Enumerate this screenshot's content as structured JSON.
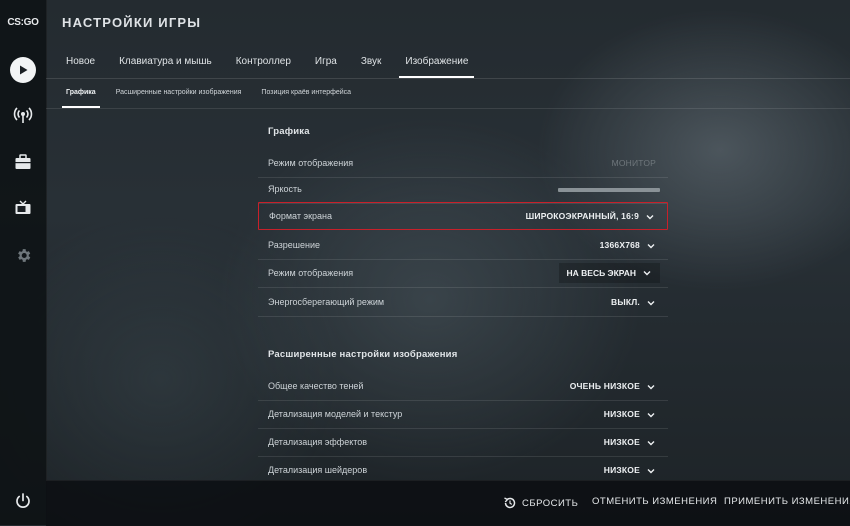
{
  "logo": {
    "text": "CS:GO"
  },
  "rail": {
    "icons": [
      "play-icon",
      "broadcast-icon",
      "briefcase-icon",
      "tv-icon",
      "gear-icon",
      "power-icon"
    ]
  },
  "header": {
    "title": "НАСТРОЙКИ ИГРЫ"
  },
  "tabs": [
    {
      "label": "Новое"
    },
    {
      "label": "Клавиатура и мышь"
    },
    {
      "label": "Контроллер"
    },
    {
      "label": "Игра"
    },
    {
      "label": "Звук"
    },
    {
      "label": "Изображение",
      "active": true
    }
  ],
  "subtabs": [
    {
      "label": "Графика",
      "active": true
    },
    {
      "label": "Расширенные настройки изображения"
    },
    {
      "label": "Позиция краёв интерфейса"
    }
  ],
  "sections": {
    "graphics": "Графика",
    "advanced": "Расширенные настройки изображения"
  },
  "rows": [
    {
      "label": "Режим отображения",
      "value": "МОНИТОР"
    },
    {
      "label": "Яркость",
      "value": "",
      "slider_fraction": 1.0
    },
    {
      "label": "Формат экрана",
      "value": "ШИРОКОЭКРАННЫЙ, 16:9"
    },
    {
      "label": "Разрешение",
      "value": "1366X768"
    },
    {
      "label": "Режим отображения",
      "value": "НА ВЕСЬ ЭКРАН"
    },
    {
      "label": "Энергосберегающий режим",
      "value": "ВЫКЛ."
    },
    {
      "label": "Общее качество теней",
      "value": "ОЧЕНЬ НИЗКОЕ"
    },
    {
      "label": "Детализация моделей и текстур",
      "value": "НИЗКОЕ"
    },
    {
      "label": "Детализация эффектов",
      "value": "НИЗКОЕ"
    },
    {
      "label": "Детализация шейдеров",
      "value": "НИЗКОЕ"
    }
  ],
  "footer": {
    "reset": "СБРОСИТЬ",
    "cancel": "ОТМЕНИТЬ ИЗМЕНЕНИЯ",
    "apply": "ПРИМЕНИТЬ ИЗМЕНЕНИЯ"
  },
  "colors": {
    "highlight": "#c8202a",
    "accent": "#ffffff"
  }
}
